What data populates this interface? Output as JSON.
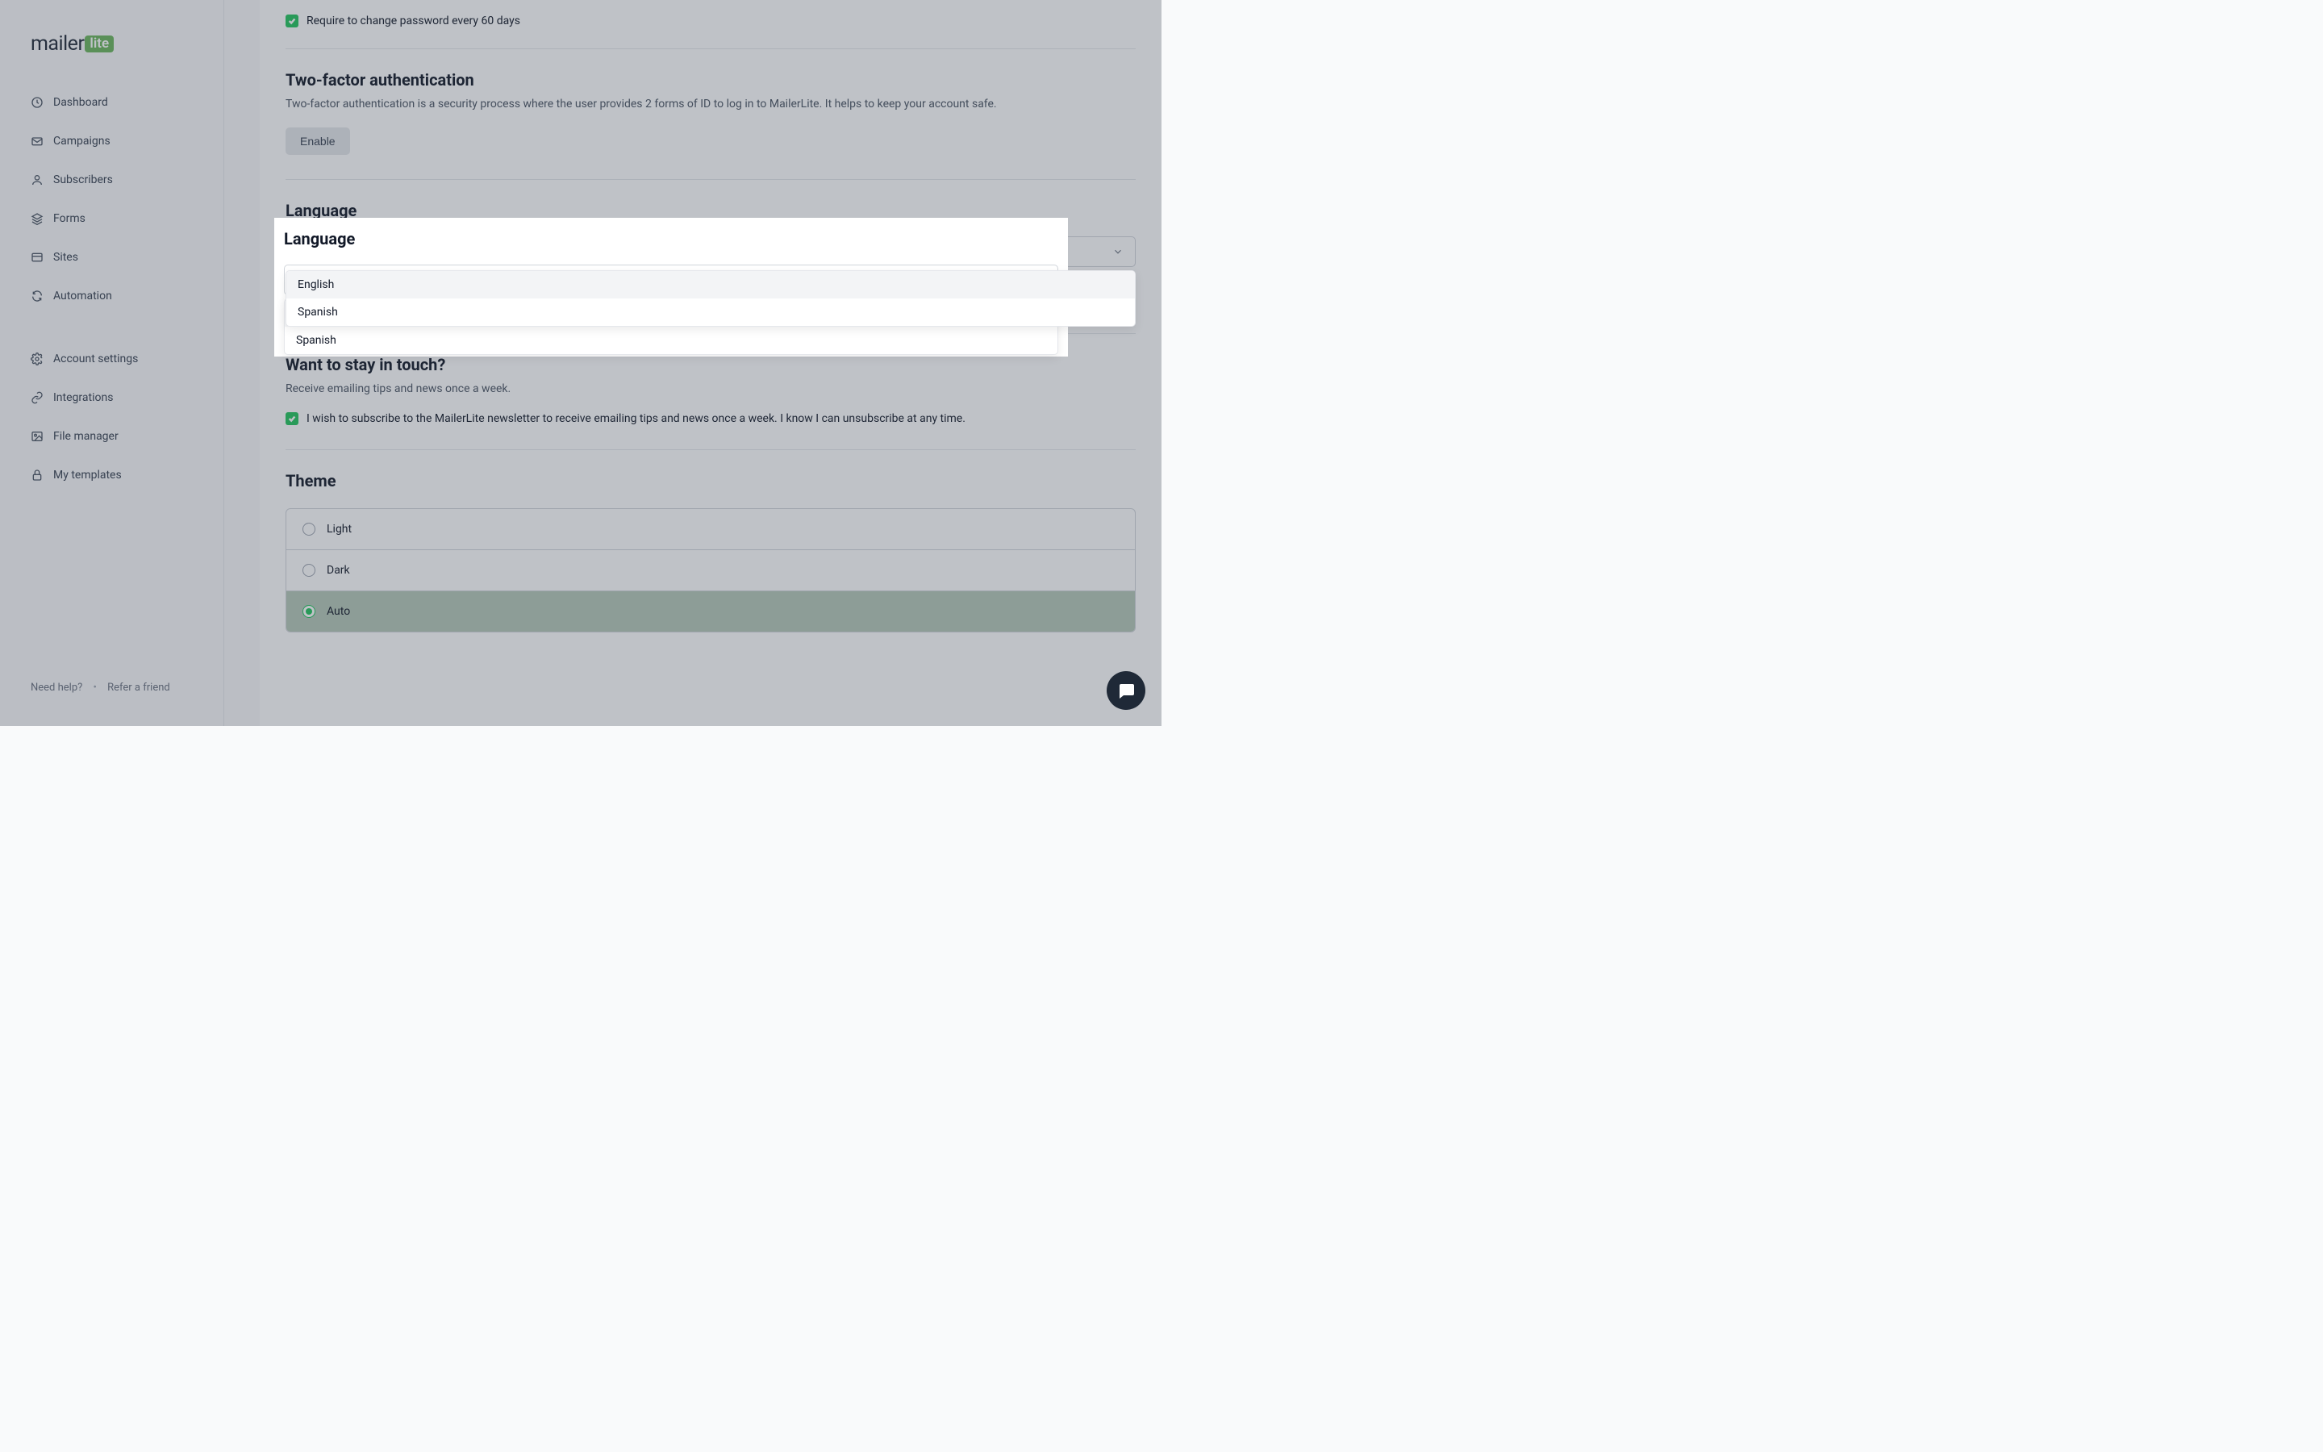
{
  "logo": {
    "text": "mailer",
    "badge": "lite"
  },
  "sidebar": {
    "items": [
      {
        "label": "Dashboard",
        "icon": "clock"
      },
      {
        "label": "Campaigns",
        "icon": "mail"
      },
      {
        "label": "Subscribers",
        "icon": "user"
      },
      {
        "label": "Forms",
        "icon": "layers"
      },
      {
        "label": "Sites",
        "icon": "window"
      },
      {
        "label": "Automation",
        "icon": "refresh"
      }
    ],
    "items2": [
      {
        "label": "Account settings",
        "icon": "gear"
      },
      {
        "label": "Integrations",
        "icon": "link"
      },
      {
        "label": "File manager",
        "icon": "image"
      },
      {
        "label": "My templates",
        "icon": "lock"
      }
    ],
    "footer": {
      "help": "Need help?",
      "refer": "Refer a friend"
    }
  },
  "password": {
    "checkbox_label": "Require to change password every 60 days"
  },
  "twofa": {
    "title": "Two-factor authentication",
    "desc": "Two-factor authentication is a security process where the user provides 2 forms of ID to log in to MailerLite. It helps to keep your account safe.",
    "button": "Enable"
  },
  "language": {
    "title": "Language",
    "selected": "English",
    "options": [
      "English",
      "Spanish"
    ]
  },
  "touch": {
    "title": "Want to stay in touch?",
    "desc": "Receive emailing tips and news once a week.",
    "checkbox_label": "I wish to subscribe to the MailerLite newsletter to receive emailing tips and news once a week. I know I can unsubscribe at any time."
  },
  "theme": {
    "title": "Theme",
    "options": [
      "Light",
      "Dark",
      "Auto"
    ],
    "selected": "Auto"
  }
}
